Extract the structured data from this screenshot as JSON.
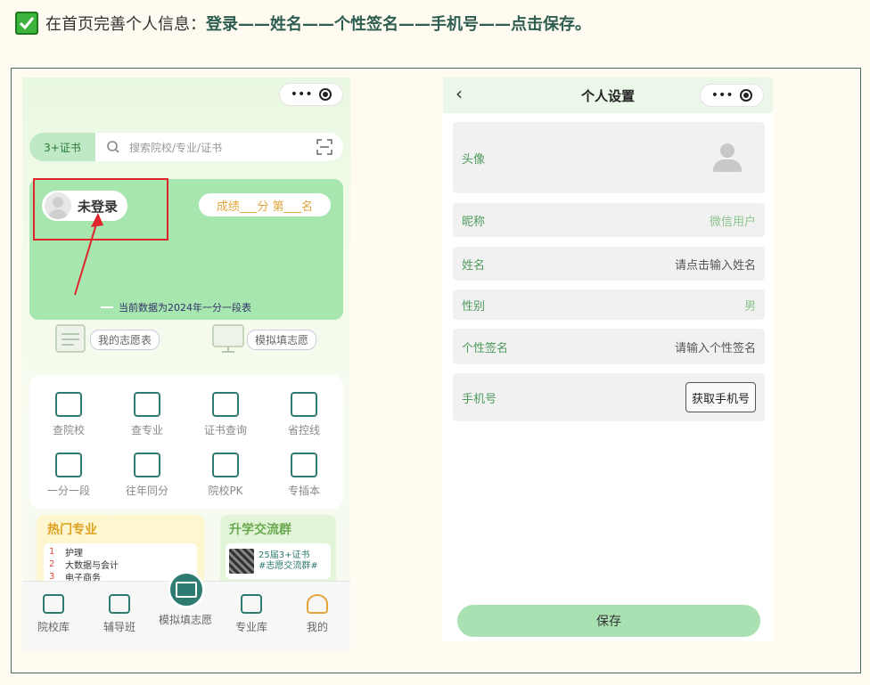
{
  "instruction": {
    "prefix": "在首页完善个人信息：",
    "steps": "登录——姓名——个性签名——手机号——点击保存。"
  },
  "phone_home": {
    "capsule_more": "•••",
    "search": {
      "tab_label": "3+证书",
      "placeholder": "搜索院校/专业/证书"
    },
    "profile_card": {
      "login_label": "未登录",
      "score_text": "成绩___分  第___名",
      "data_note": "当前数据为2024年一分一段表"
    },
    "quick_links": [
      "我的志愿表",
      "模拟填志愿"
    ],
    "grid_items": [
      "查院校",
      "查专业",
      "证书查询",
      "省控线",
      "一分一段",
      "往年同分",
      "院校PK",
      "专插本"
    ],
    "hot_majors": {
      "title": "热门专业",
      "rows": [
        {
          "rank": "1",
          "name": "护理"
        },
        {
          "rank": "2",
          "name": "大数据与会计"
        },
        {
          "rank": "3",
          "name": "电子商务"
        }
      ]
    },
    "group": {
      "title": "升学交流群",
      "line1": "25届3+证书",
      "line2": "#志愿交流群#"
    },
    "tabbar": [
      "院校库",
      "辅导班",
      "模拟填志愿",
      "专业库",
      "我的"
    ]
  },
  "phone_settings": {
    "nav_title": "个人设置",
    "back_icon": "‹",
    "rows": [
      {
        "label": "头像",
        "value": ""
      },
      {
        "label": "昵称",
        "value": "微信用户"
      },
      {
        "label": "姓名",
        "value": "请点击输入姓名"
      },
      {
        "label": "性别",
        "value": "男"
      },
      {
        "label": "个性签名",
        "value": "请输入个性签名"
      },
      {
        "label": "手机号",
        "value": "获取手机号"
      }
    ],
    "save_label": "保存"
  },
  "colors": {
    "accent_green": "#a8e6b0",
    "brand_teal": "#2e7b72",
    "highlight_red": "#e0242b"
  }
}
